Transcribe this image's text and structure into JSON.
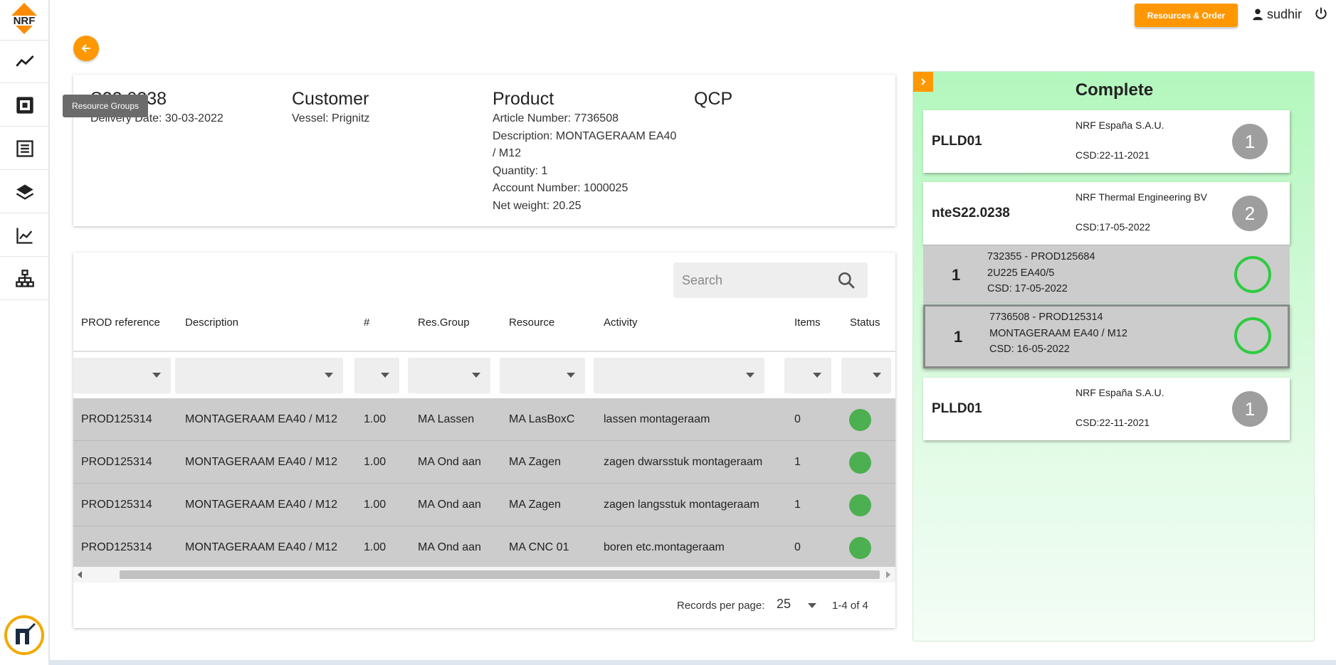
{
  "sidebar": {
    "logo_text": "NRF",
    "items": [
      {
        "name": "line-chart-icon"
      },
      {
        "name": "resource-groups-icon"
      },
      {
        "name": "list-icon"
      },
      {
        "name": "layers-icon"
      },
      {
        "name": "trend-chart-icon"
      },
      {
        "name": "sitemap-icon"
      }
    ],
    "tooltip": "Resource Groups"
  },
  "topbar": {
    "resources_order_label": "Resources & Order",
    "username": "sudhir"
  },
  "order_info": {
    "order_number": "S22.0238",
    "delivery_date": "Delivery Date: 30-03-2022",
    "customer_title": "Customer",
    "vessel": "Vessel: Prignitz",
    "product_title": "Product",
    "article_number": "Article Number: 7736508",
    "description_line1": "Description: MONTAGERAAM EA40",
    "description_line2": "/ M12",
    "quantity": "Quantity: 1",
    "account_number": "Account Number: 1000025",
    "net_weight": "Net weight: 20.25",
    "qcp_title": "QCP"
  },
  "table": {
    "search_placeholder": "Search",
    "columns": [
      "PROD reference",
      "Description",
      "#",
      "Res.Group",
      "Resource",
      "Activity",
      "Items",
      "Status"
    ],
    "rows": [
      {
        "prod": "PROD125314",
        "description": "MONTAGERAAM EA40 / M12",
        "qty": "1.00",
        "res_group": "MA Lassen",
        "resource": "MA LasBoxC",
        "activity": "lassen montageraam",
        "items": "0",
        "status": "done"
      },
      {
        "prod": "PROD125314",
        "description": "MONTAGERAAM EA40 / M12",
        "qty": "1.00",
        "res_group": "MA Ond aan",
        "resource": "MA Zagen",
        "activity": "zagen dwarsstuk montageraam",
        "items": "1",
        "status": "done"
      },
      {
        "prod": "PROD125314",
        "description": "MONTAGERAAM EA40 / M12",
        "qty": "1.00",
        "res_group": "MA Ond aan",
        "resource": "MA Zagen",
        "activity": "zagen langsstuk montageraam",
        "items": "1",
        "status": "done"
      },
      {
        "prod": "PROD125314",
        "description": "MONTAGERAAM EA40 / M12",
        "qty": "1.00",
        "res_group": "MA Ond aan",
        "resource": "MA CNC 01",
        "activity": "boren etc.montageraam",
        "items": "0",
        "status": "done"
      }
    ],
    "records_per_page_label": "Records per page:",
    "records_per_page_value": "25",
    "range_label": "1-4 of 4",
    "status_color": "#4caf50"
  },
  "right_panel": {
    "title": "Complete",
    "groups": [
      {
        "name": "PLLD01",
        "company": "NRF España S.A.U.",
        "csd": "CSD:22-11-2021",
        "badge": "1"
      },
      {
        "name": "nteS22.0238",
        "company": "NRF Thermal Engineering BV",
        "csd": "CSD:17-05-2022",
        "badge": "2"
      },
      {
        "name": "PLLD01",
        "company": "NRF España S.A.U.",
        "csd": "CSD:22-11-2021",
        "badge": "1"
      }
    ],
    "sub_items": [
      {
        "qty": "1",
        "line1": "732355 - PROD125684",
        "line2": "2U225 EA40/5",
        "line3": "CSD: 17-05-2022"
      },
      {
        "qty": "1",
        "line1": "7736508 - PROD125314",
        "line2": "MONTAGERAAM EA40 / M12",
        "line3": "CSD: 16-05-2022"
      }
    ],
    "ring_color": "#2ecc40"
  },
  "colors": {
    "accent": "#ff9800",
    "panel_green": "#b3f7bd",
    "row_grey": "#cccccc"
  }
}
